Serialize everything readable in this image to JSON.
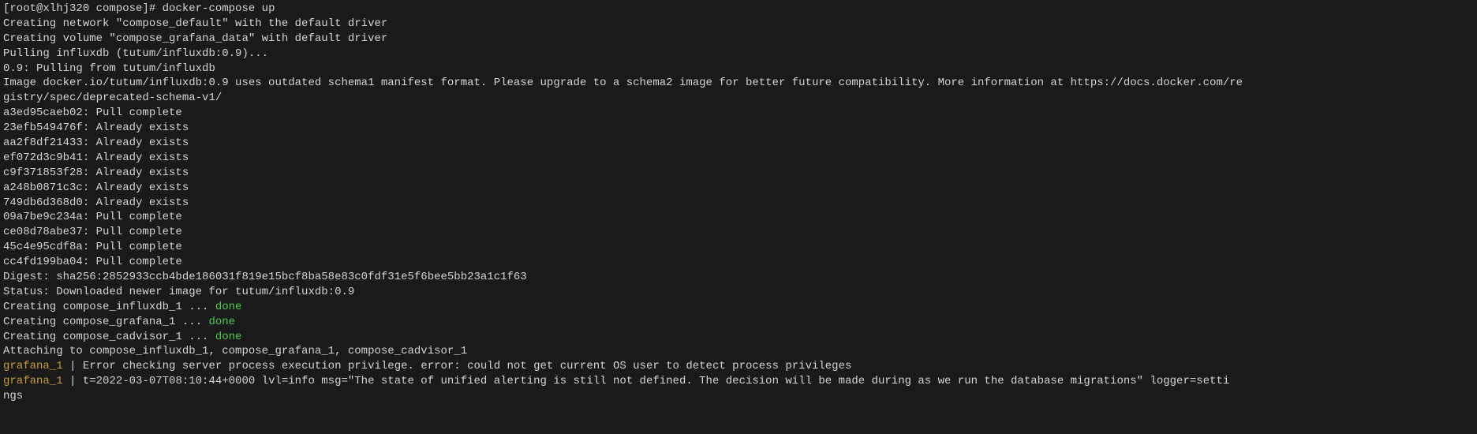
{
  "prompt": {
    "user_host": "[root@xlhj320 compose]#",
    "command": "docker-compose up"
  },
  "lines": {
    "net": "Creating network \"compose_default\" with the default driver",
    "vol": "Creating volume \"compose_grafana_data\" with default driver",
    "pull": "Pulling influxdb (tutum/influxdb:0.9)...",
    "pullfrom": "0.9: Pulling from tutum/influxdb",
    "warn1": "Image docker.io/tutum/influxdb:0.9 uses outdated schema1 manifest format. Please upgrade to a schema2 image for better future compatibility. More information at https://docs.docker.com/re",
    "warn2": "gistry/spec/deprecated-schema-v1/"
  },
  "layers": [
    {
      "id": "a3ed95caeb02",
      "status": "Pull complete"
    },
    {
      "id": "23efb549476f",
      "status": "Already exists"
    },
    {
      "id": "aa2f8df21433",
      "status": "Already exists"
    },
    {
      "id": "ef072d3c9b41",
      "status": "Already exists"
    },
    {
      "id": "c9f371853f28",
      "status": "Already exists"
    },
    {
      "id": "a248b0871c3c",
      "status": "Already exists"
    },
    {
      "id": "749db6d368d0",
      "status": "Already exists"
    },
    {
      "id": "09a7be9c234a",
      "status": "Pull complete"
    },
    {
      "id": "ce08d78abe37",
      "status": "Pull complete"
    },
    {
      "id": "45c4e95cdf8a",
      "status": "Pull complete"
    },
    {
      "id": "cc4fd199ba04",
      "status": "Pull complete"
    }
  ],
  "after": {
    "digest": "Digest: sha256:2852933ccb4bde186031f819e15bcf8ba58e83c0fdf31e5f6bee5bb23a1c1f63",
    "status": "Status: Downloaded newer image for tutum/influxdb:0.9"
  },
  "creates": [
    {
      "text": "Creating compose_influxdb_1 ... ",
      "done": "done"
    },
    {
      "text": "Creating compose_grafana_1  ... ",
      "done": "done"
    },
    {
      "text": "Creating compose_cadvisor_1 ... ",
      "done": "done"
    }
  ],
  "attach": "Attaching to compose_influxdb_1, compose_grafana_1, compose_cadvisor_1",
  "logs": [
    {
      "svc": "grafana_1   ",
      "sep": "| ",
      "msg": "Error checking server process execution privilege. error: could not get current OS user to detect process privileges"
    },
    {
      "svc": "grafana_1   ",
      "sep": "| ",
      "msg": "t=2022-03-07T08:10:44+0000 lvl=info msg=\"The state of unified alerting is still not defined. The decision will be made during as we run the database migrations\" logger=setti"
    }
  ],
  "tail": "ngs"
}
